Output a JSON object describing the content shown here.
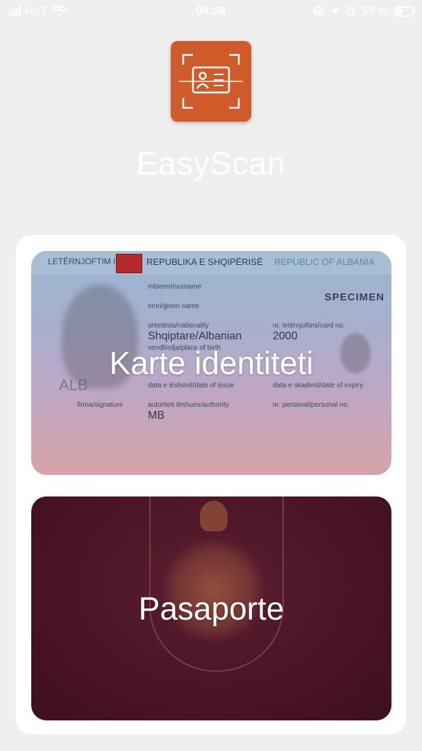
{
  "status_bar": {
    "carrier": "HoT",
    "time": "04:08",
    "battery": "59 %"
  },
  "app": {
    "name": "EasyScan",
    "brand_color": "#cf5a2a"
  },
  "options": [
    {
      "label": "Karte identiteti",
      "card_header": {
        "left": "LETËRNJOFTIM ID",
        "center": "REPUBLIKA E SHQIPËRISË",
        "right": "REPUBLIC OF ALBANIA"
      },
      "specimen": "SPECIMEN",
      "fields": {
        "surname": "mbiemri/surname",
        "given_name": "emri/given name",
        "nationality": "shtetësia/nationality",
        "nationality_value": "Shqiptare/Albanian",
        "card_no": "nr. letërnjoftimi/card no.",
        "card_no_value": "2000",
        "place_of_birth": "vendlindja/place of birth",
        "date_of_issue": "data e lëshimit/date of issue",
        "date_of_expiry": "data e skadimit/date of expiry",
        "signature": "firma/signature",
        "authority": "autoriteti lëshues/authority",
        "authority_value": "MB",
        "personal_no": "nr. personal/personal no.",
        "country_code": "ALB"
      }
    },
    {
      "label": "Pasaporte"
    }
  ]
}
